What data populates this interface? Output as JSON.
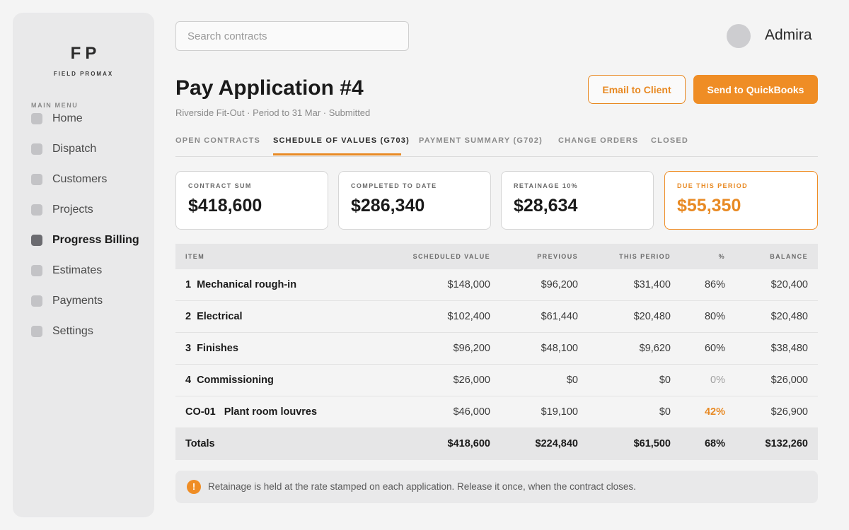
{
  "brand": {
    "mark": "FP",
    "name": "FIELD PROMAX"
  },
  "sidebar": {
    "section_label": "MAIN MENU",
    "items": [
      {
        "label": "Home",
        "active": false
      },
      {
        "label": "Dispatch",
        "active": false
      },
      {
        "label": "Customers",
        "active": false
      },
      {
        "label": "Projects",
        "active": false
      },
      {
        "label": "Progress Billing",
        "active": true
      },
      {
        "label": "Estimates",
        "active": false
      },
      {
        "label": "Payments",
        "active": false
      },
      {
        "label": "Settings",
        "active": false
      }
    ]
  },
  "search": {
    "placeholder": "Search contracts",
    "value": ""
  },
  "user": {
    "name": "Admira"
  },
  "header": {
    "title": "Pay Application #4",
    "subtitle": "Riverside Fit-Out · Period to 31 Mar · Submitted",
    "email_button": "Email to Client",
    "send_button": "Send to QuickBooks"
  },
  "tabs": [
    {
      "label": "OPEN CONTRACTS",
      "active": false
    },
    {
      "label": "SCHEDULE OF VALUES (G703)",
      "active": true
    },
    {
      "label": "PAYMENT SUMMARY (G702)",
      "active": false
    },
    {
      "label": "CHANGE ORDERS",
      "active": false
    },
    {
      "label": "CLOSED",
      "active": false
    }
  ],
  "stats": [
    {
      "label": "CONTRACT SUM",
      "value": "$418,600"
    },
    {
      "label": "COMPLETED TO DATE",
      "value": "$286,340"
    },
    {
      "label": "RETAINAGE 10%",
      "value": "$28,634"
    },
    {
      "label": "DUE THIS PERIOD",
      "value": "$55,350",
      "highlight": true
    }
  ],
  "table": {
    "headers": {
      "item": "ITEM",
      "scheduled": "SCHEDULED VALUE",
      "previous": "PREVIOUS",
      "this_period": "THIS PERIOD",
      "pct": "%",
      "balance": "BALANCE"
    },
    "rows": [
      {
        "num": "1",
        "name": "Mechanical rough-in",
        "scheduled": "$148,000",
        "previous": "$96,200",
        "this_period": "$31,400",
        "pct": "86%",
        "balance": "$20,400"
      },
      {
        "num": "2",
        "name": "Electrical",
        "scheduled": "$102,400",
        "previous": "$61,440",
        "this_period": "$20,480",
        "pct": "80%",
        "balance": "$20,480"
      },
      {
        "num": "3",
        "name": "Finishes",
        "scheduled": "$96,200",
        "previous": "$48,100",
        "this_period": "$9,620",
        "pct": "60%",
        "balance": "$38,480"
      },
      {
        "num": "4",
        "name": "Commissioning",
        "scheduled": "$26,000",
        "previous": "$0",
        "this_period": "$0",
        "pct": "0%",
        "balance": "$26,000"
      },
      {
        "num": "CO-01",
        "name": "Plant room louvres",
        "scheduled": "$46,000",
        "previous": "$19,100",
        "this_period": "$0",
        "pct": "42%",
        "balance": "$26,900"
      }
    ],
    "totals": {
      "label": "Totals",
      "scheduled": "$418,600",
      "previous": "$224,840",
      "this_period": "$61,500",
      "pct": "68%",
      "balance": "$132,260"
    }
  },
  "note": {
    "icon": "!",
    "text": "Retainage is held at the rate stamped on each application. Release it once, when the contract closes."
  },
  "colors": {
    "accent": "#ef8d25",
    "accent_text": "#e88a24",
    "sidebar_bg": "#e9e9ea"
  }
}
